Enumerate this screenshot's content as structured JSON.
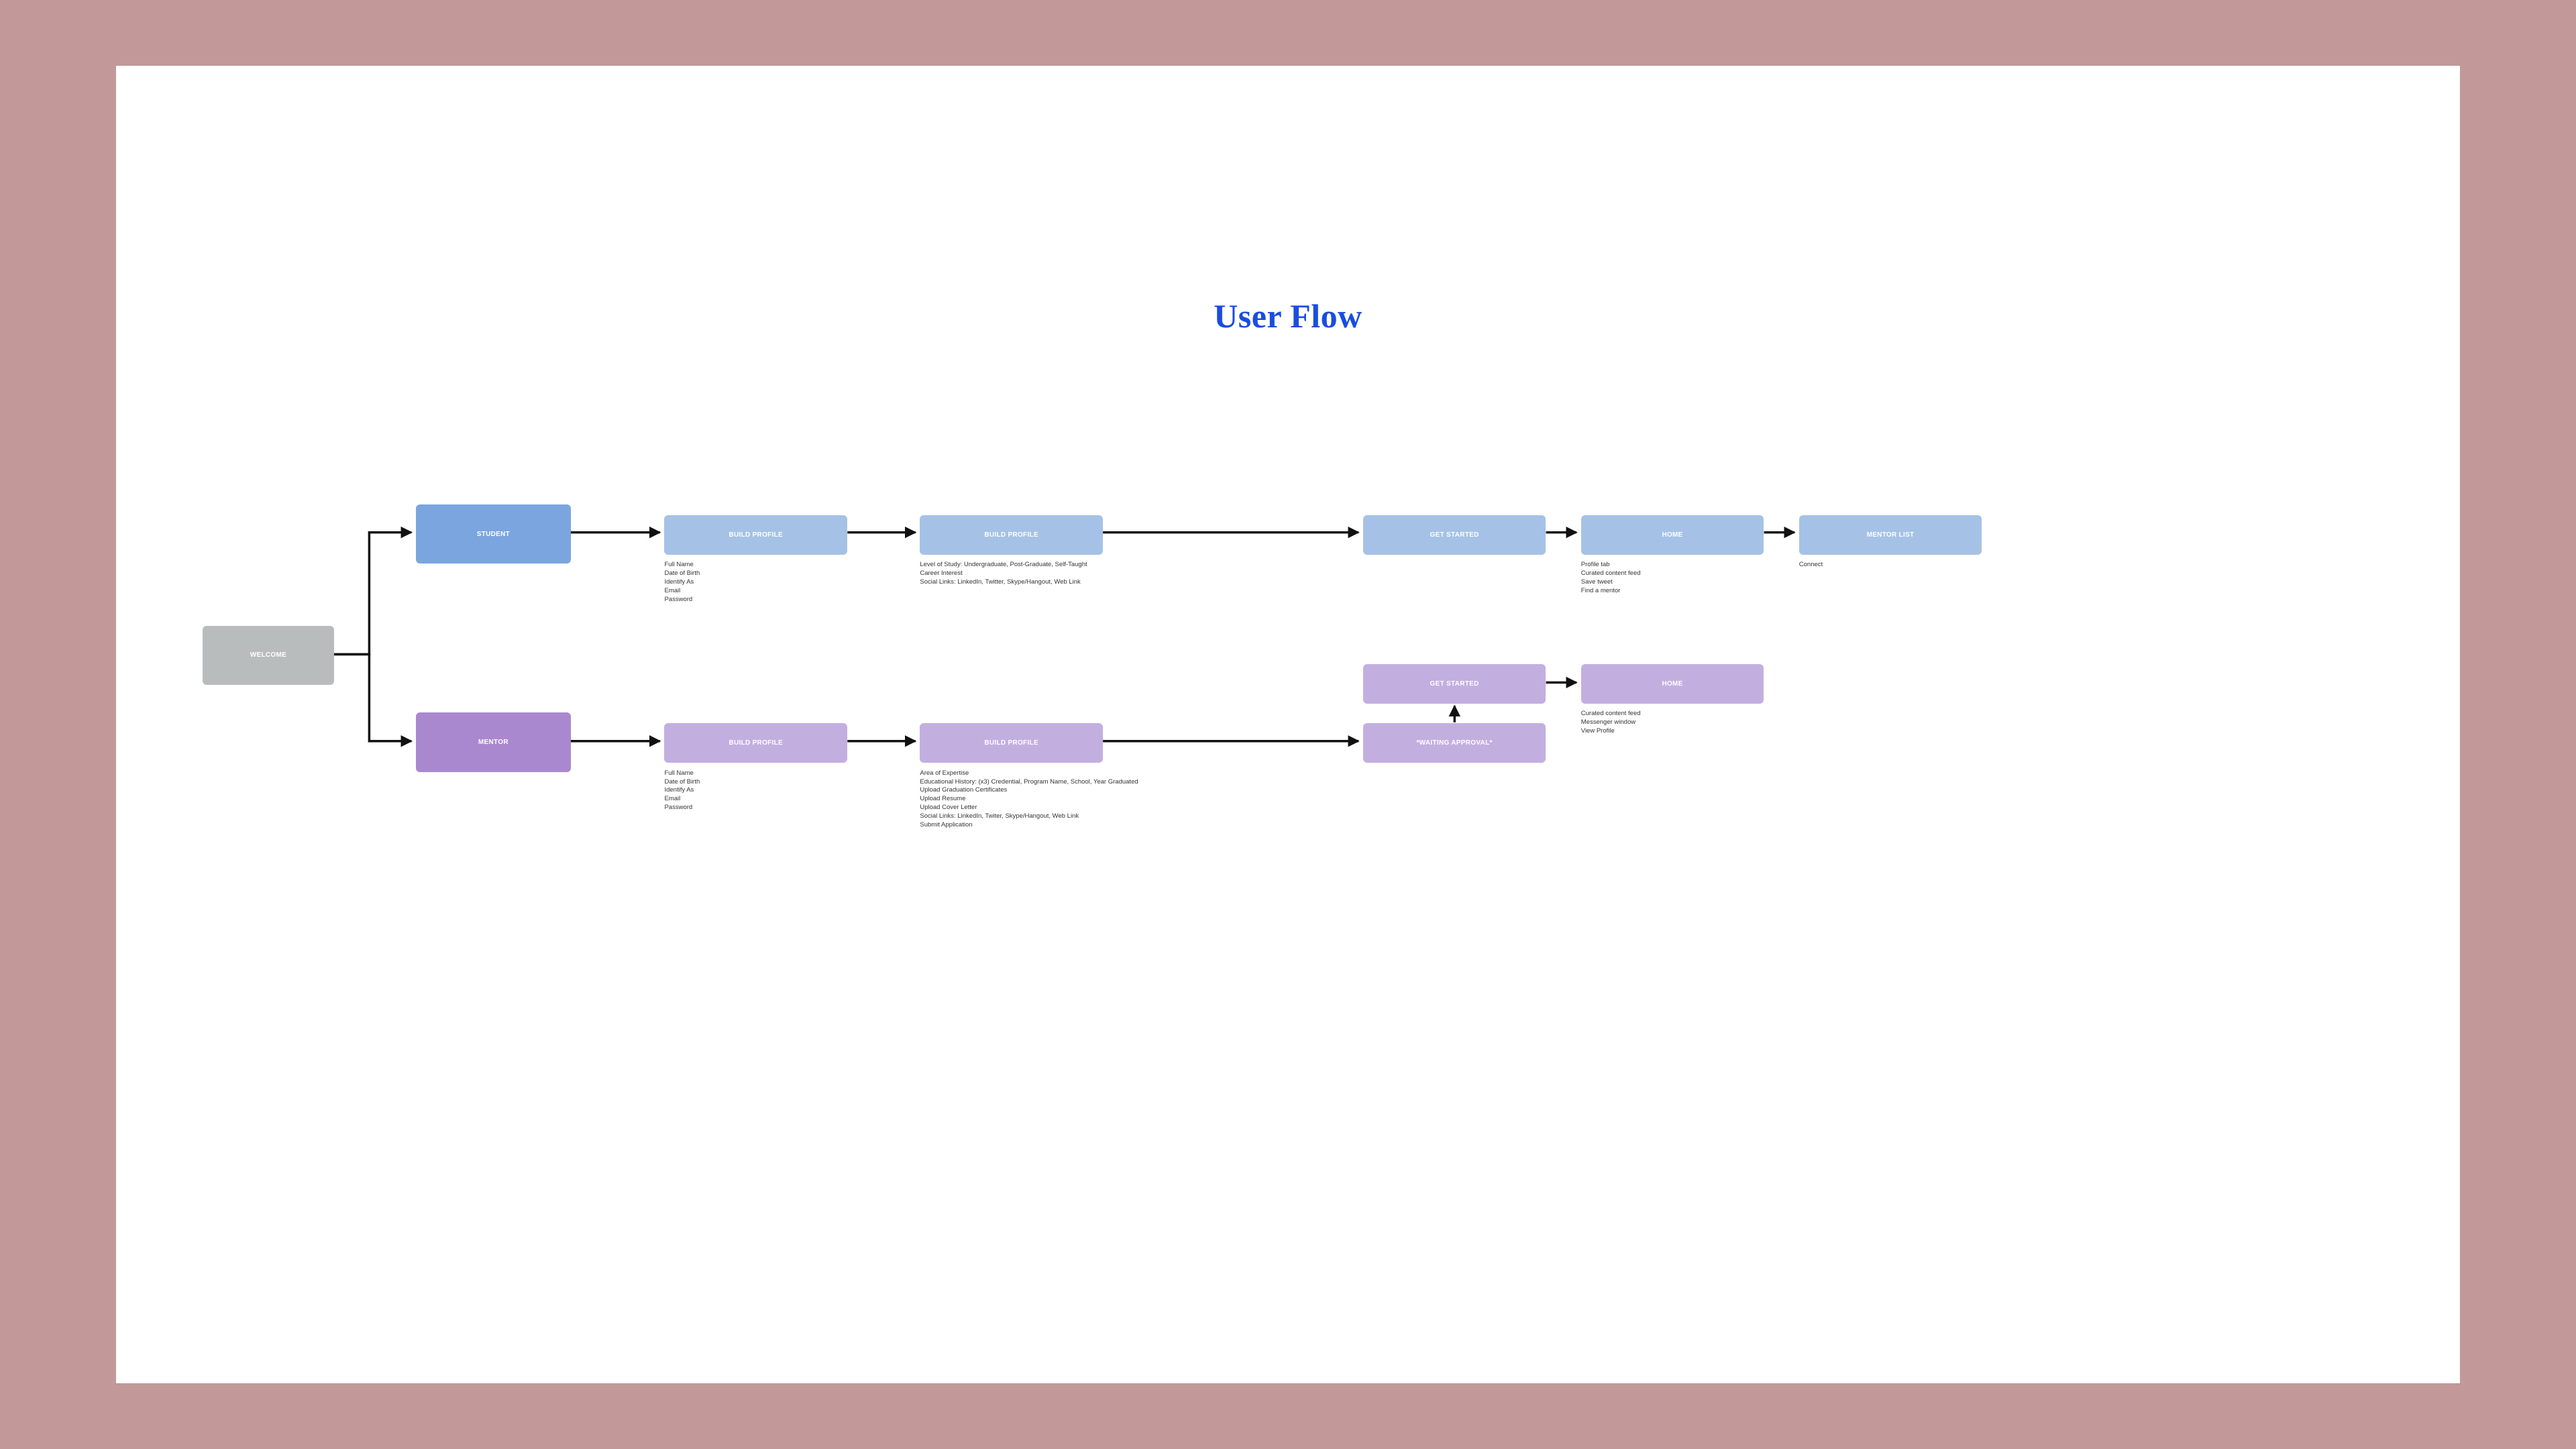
{
  "title": "User Flow",
  "nodes": {
    "welcome": "WELCOME",
    "student": "STUDENT",
    "mentor": "MENTOR",
    "s_build1": "BUILD PROFILE",
    "s_build2": "BUILD PROFILE",
    "s_getstarted": "GET STARTED",
    "s_home": "HOME",
    "s_mentorlist": "MENTOR LIST",
    "m_build1": "BUILD PROFILE",
    "m_build2": "BUILD PROFILE",
    "m_getstarted": "GET STARTED",
    "m_waiting": "*WAITING APPROVAL*",
    "m_home": "HOME"
  },
  "details": {
    "s_build1": [
      "Full Name",
      "Date of Birth",
      "Identify As",
      "Email",
      "Password"
    ],
    "s_build2": [
      "Level of Study: Undergraduate, Post-Graduate, Self-Taught",
      "Career Interest",
      "Social Links: LinkedIn, Twitter, Skype/Hangout, Web Link"
    ],
    "s_home": [
      "Profile tab",
      "Curated content feed",
      "Save tweet",
      "Find a mentor"
    ],
    "s_mentorlist": [
      "Connect"
    ],
    "m_build1": [
      "Full Name",
      "Date of Birth",
      "Identify As",
      "Email",
      "Password"
    ],
    "m_build2": [
      "Area of Expertise",
      "Educational History: (x3) Credential, Program Name, School, Year Graduated",
      "Upload Graduation Certificates",
      "Upload Resume",
      "Upload Cover Letter",
      "Social Links: LinkedIn, Twiter, Skype/Hangout, Web Link",
      "Submit Application"
    ],
    "m_home": [
      "Curated content feed",
      "Messenger window",
      "View Profile"
    ]
  }
}
